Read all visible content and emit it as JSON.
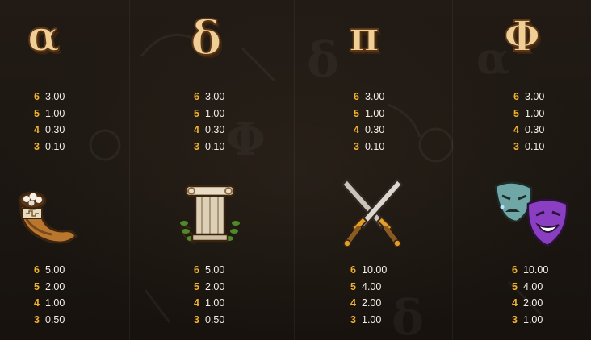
{
  "paytable": [
    {
      "symbol": "alpha",
      "glyph": "α",
      "icon": "alpha-letter-icon",
      "pays": [
        {
          "count": "6",
          "value": "3.00"
        },
        {
          "count": "5",
          "value": "1.00"
        },
        {
          "count": "4",
          "value": "0.30"
        },
        {
          "count": "3",
          "value": "0.10"
        }
      ]
    },
    {
      "symbol": "delta",
      "glyph": "δ",
      "icon": "delta-letter-icon",
      "pays": [
        {
          "count": "6",
          "value": "3.00"
        },
        {
          "count": "5",
          "value": "1.00"
        },
        {
          "count": "4",
          "value": "0.30"
        },
        {
          "count": "3",
          "value": "0.10"
        }
      ]
    },
    {
      "symbol": "pi",
      "glyph": "π",
      "icon": "pi-letter-icon",
      "pays": [
        {
          "count": "6",
          "value": "3.00"
        },
        {
          "count": "5",
          "value": "1.00"
        },
        {
          "count": "4",
          "value": "0.30"
        },
        {
          "count": "3",
          "value": "0.10"
        }
      ]
    },
    {
      "symbol": "phi",
      "glyph": "Φ",
      "icon": "phi-letter-icon",
      "pays": [
        {
          "count": "6",
          "value": "3.00"
        },
        {
          "count": "5",
          "value": "1.00"
        },
        {
          "count": "4",
          "value": "0.30"
        },
        {
          "count": "3",
          "value": "0.10"
        }
      ]
    },
    {
      "symbol": "horn",
      "icon": "cornucopia-horn-icon",
      "pays": [
        {
          "count": "6",
          "value": "5.00"
        },
        {
          "count": "5",
          "value": "2.00"
        },
        {
          "count": "4",
          "value": "1.00"
        },
        {
          "count": "3",
          "value": "0.50"
        }
      ]
    },
    {
      "symbol": "column",
      "icon": "greek-column-laurel-icon",
      "pays": [
        {
          "count": "6",
          "value": "5.00"
        },
        {
          "count": "5",
          "value": "2.00"
        },
        {
          "count": "4",
          "value": "1.00"
        },
        {
          "count": "3",
          "value": "0.50"
        }
      ]
    },
    {
      "symbol": "swords",
      "icon": "crossed-swords-icon",
      "pays": [
        {
          "count": "6",
          "value": "10.00"
        },
        {
          "count": "5",
          "value": "4.00"
        },
        {
          "count": "4",
          "value": "2.00"
        },
        {
          "count": "3",
          "value": "1.00"
        }
      ]
    },
    {
      "symbol": "masks",
      "icon": "theater-masks-icon",
      "pays": [
        {
          "count": "6",
          "value": "10.00"
        },
        {
          "count": "5",
          "value": "4.00"
        },
        {
          "count": "4",
          "value": "2.00"
        },
        {
          "count": "3",
          "value": "1.00"
        }
      ]
    }
  ],
  "colors": {
    "count": "#f2b12d",
    "value": "#f3efe8",
    "background": "#1b1611",
    "letter": "#f0cf97"
  }
}
